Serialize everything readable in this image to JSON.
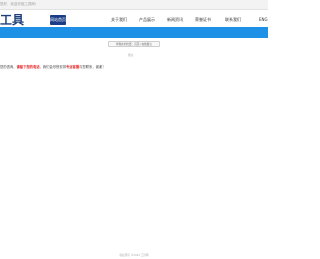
{
  "topbar": {
    "text": "您好，欢迎光临工具网!"
  },
  "header": {
    "logo_text": "工具"
  },
  "nav": {
    "items": [
      {
        "label": "网站首页"
      },
      {
        "label": "关于我们"
      },
      {
        "label": "产品展示"
      },
      {
        "label": "新闻资讯"
      },
      {
        "label": "荣誉证书"
      },
      {
        "label": "联系我们"
      },
      {
        "label": "ENG"
      }
    ]
  },
  "main": {
    "notice_button": "你现在的位置：首页>在线留言",
    "small_label": "留言",
    "message": {
      "part1": "您的咨询，",
      "red1": "请留下您的电话",
      "part2": "，我们会尽快安排",
      "red2": "专业客服",
      "part3": "与您联系，谢谢！"
    }
  },
  "footer": {
    "text": "版权所有 ©2024 工具网"
  },
  "colors": {
    "blue_band": "#1e90e6",
    "nav_active": "#1b3c86",
    "accent_red": "#e01e1e"
  }
}
